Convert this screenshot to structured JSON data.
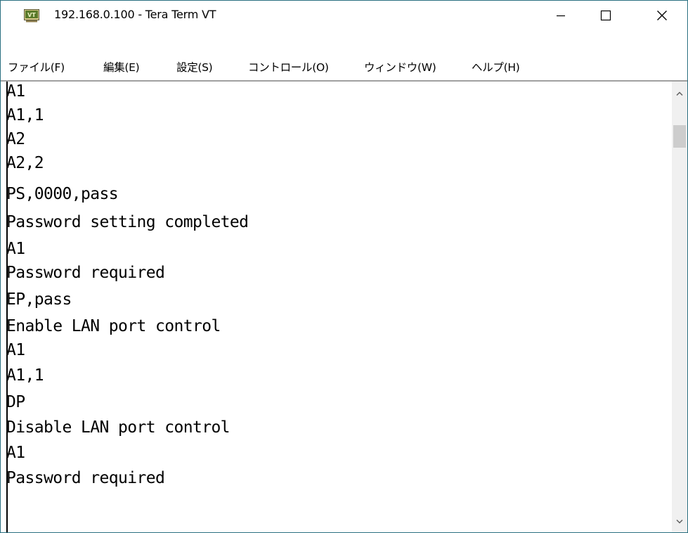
{
  "window": {
    "title": "192.168.0.100 - Tera Term VT",
    "icon": "tera-term-vt-icon"
  },
  "controls": {
    "minimize": "—",
    "maximize": "☐",
    "close": "✕"
  },
  "menu": {
    "items": [
      {
        "label": "ファイル(F)"
      },
      {
        "label": "編集(E)"
      },
      {
        "label": "設定(S)"
      },
      {
        "label": "コントロール(O)"
      },
      {
        "label": "ウィンドウ(W)"
      },
      {
        "label": "ヘルプ(H)"
      }
    ]
  },
  "terminal": {
    "lines": [
      "A1",
      "A1,1",
      "A2",
      "A2,2",
      "PS,0000,pass",
      "Password setting completed",
      "A1",
      "Password required",
      "EP,pass",
      "Enable LAN port control",
      "A1",
      "A1,1",
      "DP",
      "Disable LAN port control",
      "A1",
      "Password required"
    ]
  },
  "scrollbar": {
    "up_icon": "chevron-up-icon",
    "down_icon": "chevron-down-icon"
  }
}
